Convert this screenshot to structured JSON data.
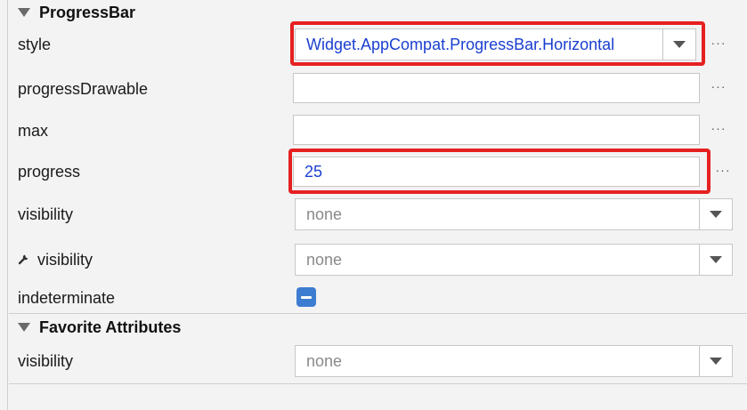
{
  "sections": {
    "progressbar_title": "ProgressBar",
    "favorites_title": "Favorite Attributes"
  },
  "rows": {
    "style": {
      "label": "style",
      "value": "Widget.AppCompat.ProgressBar.Horizontal"
    },
    "progressDrawable": {
      "label": "progressDrawable",
      "value": ""
    },
    "max": {
      "label": "max",
      "value": ""
    },
    "progress": {
      "label": "progress",
      "value": "25"
    },
    "visibility": {
      "label": "visibility",
      "value": "none"
    },
    "tools_visibility": {
      "label": "visibility",
      "value": "none"
    },
    "indeterminate": {
      "label": "indeterminate",
      "state": "indeterminate"
    },
    "fav_visibility": {
      "label": "visibility",
      "value": "none"
    }
  },
  "ellipsis": "···",
  "icons": {
    "section_toggle": "triangle-down-icon",
    "dropdown": "chevron-down-icon",
    "tools_attribute": "wrench-icon",
    "more": "ellipsis-icon"
  },
  "colors": {
    "highlight": "#e62020",
    "value_text": "#1a3fd0",
    "checkbox": "#3d7dd1"
  }
}
